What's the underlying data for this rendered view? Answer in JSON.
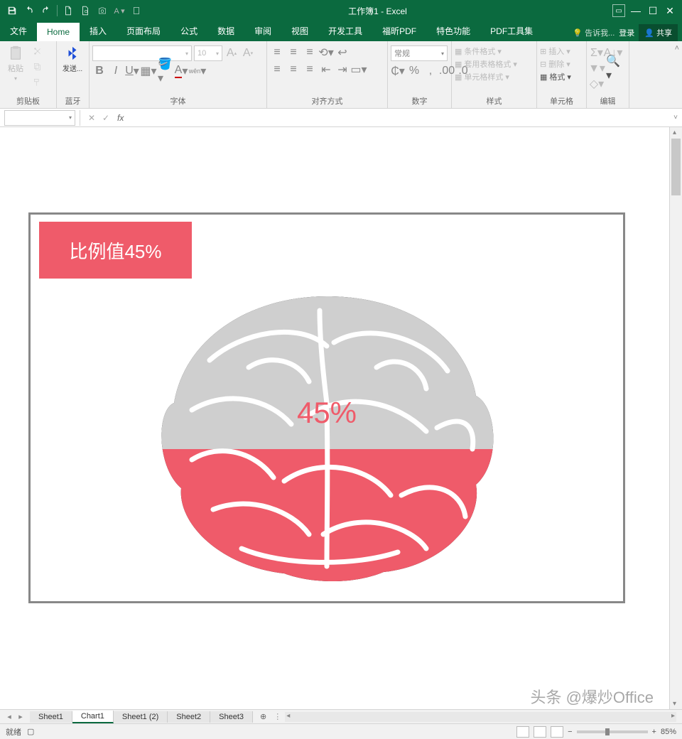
{
  "app": {
    "title": "工作簿1 - Excel"
  },
  "qat": {
    "save": "保存",
    "undo": "撤销",
    "redo": "重做"
  },
  "window": {
    "login": "登录",
    "share": "共享",
    "tellme": "告诉我..."
  },
  "tabs": [
    "文件",
    "Home",
    "插入",
    "页面布局",
    "公式",
    "数据",
    "审阅",
    "视图",
    "开发工具",
    "福昕PDF",
    "特色功能",
    "PDF工具集"
  ],
  "active_tab": 1,
  "ribbon": {
    "clipboard": {
      "label": "剪贴板",
      "paste": "粘贴"
    },
    "bluetooth": {
      "label": "蓝牙",
      "send": "发送..."
    },
    "font": {
      "label": "字体",
      "family": "",
      "size": "10",
      "bold": "B",
      "italic": "I",
      "underline": "U"
    },
    "alignment": {
      "label": "对齐方式"
    },
    "number": {
      "label": "数字",
      "format": "常规",
      "percent": "%",
      "comma": ","
    },
    "styles": {
      "label": "样式",
      "cond": "条件格式",
      "table": "套用表格格式",
      "cell": "单元格样式"
    },
    "cells": {
      "label": "单元格",
      "insert": "插入",
      "delete": "删除",
      "format": "格式"
    },
    "editing": {
      "label": "编辑"
    }
  },
  "formula_bar": {
    "name": "",
    "fx": "fx",
    "formula": ""
  },
  "chart_data": {
    "type": "pictograph-fill",
    "title": "比例值45%",
    "value_label": "45%",
    "fill_percent": 45,
    "empty_percent": 55,
    "colors": {
      "fill": "#ef5b6a",
      "empty": "#cfcfcf"
    },
    "shape": "brain"
  },
  "sheets": {
    "items": [
      "Sheet1",
      "Chart1",
      "Sheet1 (2)",
      "Sheet2",
      "Sheet3"
    ],
    "active": 1
  },
  "status": {
    "ready": "就绪",
    "zoom": "85%"
  },
  "watermark": "头条 @爆炒Office"
}
